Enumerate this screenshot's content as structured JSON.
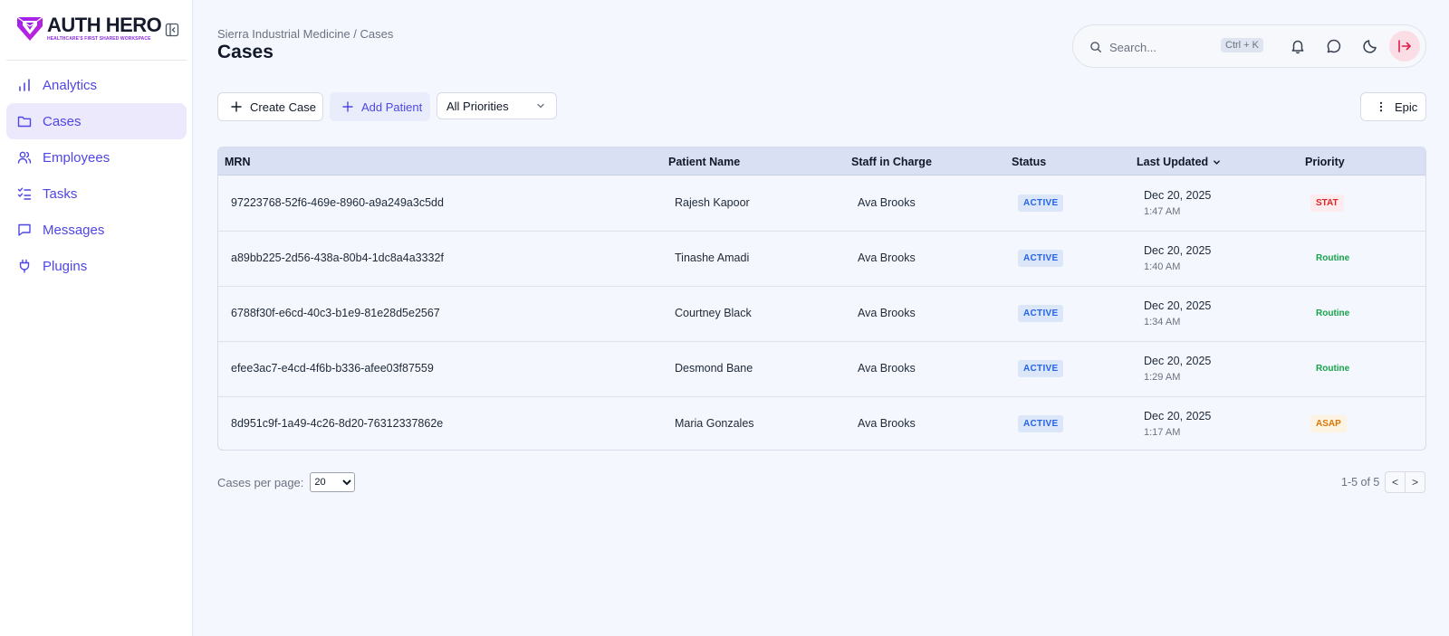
{
  "brand": {
    "name": "AUTH HERO",
    "tagline": "HEALTHCARE'S FIRST SHARED WORKSPACE",
    "accent": "#8a2be2"
  },
  "sidebar": {
    "items": [
      {
        "label": "Analytics",
        "icon": "bar-chart-icon"
      },
      {
        "label": "Cases",
        "icon": "folder-icon",
        "active": true
      },
      {
        "label": "Employees",
        "icon": "users-icon"
      },
      {
        "label": "Tasks",
        "icon": "list-checks-icon"
      },
      {
        "label": "Messages",
        "icon": "message-square-icon"
      },
      {
        "label": "Plugins",
        "icon": "plug-icon"
      }
    ]
  },
  "header": {
    "breadcrumb": "Sierra Industrial Medicine / Cases",
    "title": "Cases"
  },
  "topbar": {
    "search_placeholder": "Search...",
    "shortcut": "Ctrl + K",
    "icons": [
      "bell-icon",
      "message-circle-icon",
      "moon-icon",
      "logout-icon"
    ]
  },
  "toolbar": {
    "create_case": "Create Case",
    "add_patient": "Add Patient",
    "priority_filter": "All Priorities",
    "epic": "Epic"
  },
  "table": {
    "headers": {
      "mrn": "MRN",
      "patient": "Patient Name",
      "staff": "Staff in Charge",
      "status": "Status",
      "updated": "Last Updated",
      "priority": "Priority"
    },
    "rows": [
      {
        "mrn": "97223768-52f6-469e-8960-a9a249a3c5dd",
        "patient": "Rajesh Kapoor",
        "staff": "Ava Brooks",
        "status": "ACTIVE",
        "date": "Dec 20, 2025",
        "time": "1:47 AM",
        "priority": "STAT"
      },
      {
        "mrn": "a89bb225-2d56-438a-80b4-1dc8a4a3332f",
        "patient": "Tinashe Amadi",
        "staff": "Ava Brooks",
        "status": "ACTIVE",
        "date": "Dec 20, 2025",
        "time": "1:40 AM",
        "priority": "Routine"
      },
      {
        "mrn": "6788f30f-e6cd-40c3-b1e9-81e28d5e2567",
        "patient": "Courtney Black",
        "staff": "Ava Brooks",
        "status": "ACTIVE",
        "date": "Dec 20, 2025",
        "time": "1:34 AM",
        "priority": "Routine"
      },
      {
        "mrn": "efee3ac7-e4cd-4f6b-b336-afee03f87559",
        "patient": "Desmond Bane",
        "staff": "Ava Brooks",
        "status": "ACTIVE",
        "date": "Dec 20, 2025",
        "time": "1:29 AM",
        "priority": "Routine"
      },
      {
        "mrn": "8d951c9f-1a49-4c26-8d20-76312337862e",
        "patient": "Maria Gonzales",
        "staff": "Ava Brooks",
        "status": "ACTIVE",
        "date": "Dec 20, 2025",
        "time": "1:17 AM",
        "priority": "ASAP"
      }
    ]
  },
  "priority_colors": {
    "STAT": {
      "fg": "#dc2626",
      "bg": "#fdebee"
    },
    "Routine": {
      "fg": "#16a34a",
      "bg": "#f4f7fd"
    },
    "ASAP": {
      "fg": "#d97706",
      "bg": "#fdf3e3"
    }
  },
  "pagination": {
    "per_page_label": "Cases per page:",
    "per_page_value": "20",
    "info": "1-5 of 5",
    "prev": "<",
    "next": ">"
  }
}
